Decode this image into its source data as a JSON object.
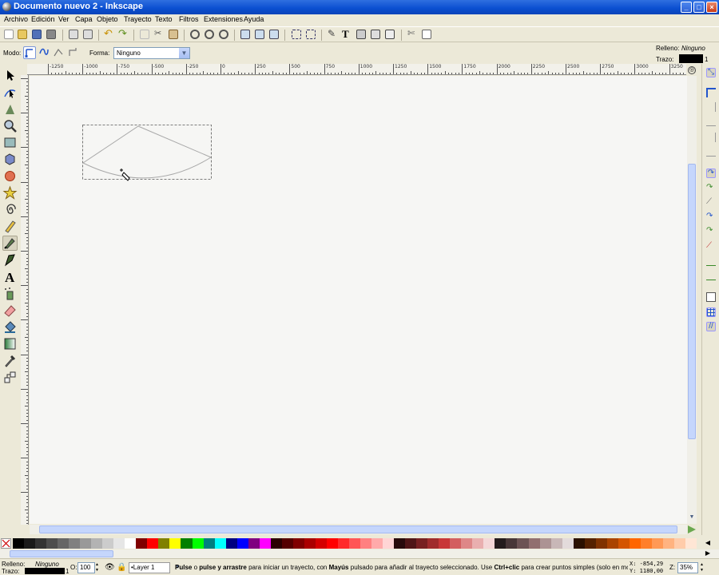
{
  "window": {
    "title": "Documento nuevo 2 - Inkscape",
    "min": "_",
    "max": "□",
    "close": "×"
  },
  "menu": [
    "Archivo",
    "Edición",
    "Ver",
    "Capa",
    "Objeto",
    "Trayecto",
    "Texto",
    "Filtros",
    "Extensiones",
    "Ayuda"
  ],
  "toolcontrols": {
    "mode_label": "Modo:",
    "shape_label": "Forma:",
    "shape_value": "Ninguno",
    "fill_label": "Relleno:",
    "fill_value": "Ninguno",
    "stroke_label": "Trazo:",
    "stroke_width": "1"
  },
  "ruler": {
    "labels": [
      "-1250",
      "-1000",
      "-750",
      "-500",
      "-250",
      "0",
      "250",
      "500",
      "750",
      "1000",
      "1250",
      "1500",
      "1750",
      "2000",
      "2250",
      "2500",
      "2750",
      "3000",
      "3250",
      "3500"
    ]
  },
  "palette": [
    "#000000",
    "#1a1a1a",
    "#333333",
    "#4d4d4d",
    "#666666",
    "#808080",
    "#999999",
    "#b3b3b3",
    "#cccccc",
    "#e6e6e6",
    "#ffffff",
    "#800000",
    "#ff0000",
    "#808000",
    "#ffff00",
    "#008000",
    "#00ff00",
    "#008080",
    "#00ffff",
    "#000080",
    "#0000ff",
    "#800080",
    "#ff00ff",
    "#2b0000",
    "#550000",
    "#800000",
    "#aa0000",
    "#d40000",
    "#ff0000",
    "#ff2a2a",
    "#ff5555",
    "#ff8080",
    "#ffaaaa",
    "#ffd5d5",
    "#280b0b",
    "#501616",
    "#782121",
    "#a02c2c",
    "#c83737",
    "#d35f5f",
    "#de8787",
    "#e9afaf",
    "#f4d7d7",
    "#241c1c",
    "#483737",
    "#6c5353",
    "#916f6f",
    "#ac9393",
    "#c8b7b7",
    "#e3dbdb",
    "#2b1100",
    "#552200",
    "#803300",
    "#aa4400",
    "#d45500",
    "#ff6600",
    "#ff7f2a",
    "#ff9955",
    "#ffb380",
    "#ffccaa",
    "#ffe6d5"
  ],
  "status": {
    "fill_label": "Relleno:",
    "fill_value": "Ninguno",
    "stroke_label": "Trazo:",
    "opacity_label": "O:",
    "opacity_value": "100",
    "layer": "•Layer 1",
    "msg_pre": "Pulse",
    "msg_b1": "o",
    "msg_b2": "pulse y arrastre",
    "msg_mid": "para iniciar un trayecto, con",
    "msg_b3": "Mayús",
    "msg_mid2": "pulsado para añadir al trayecto seleccionado. Use",
    "msg_b4": "Ctrl+clic",
    "msg_end": "para crear puntos simples (solo en modo d",
    "x_coord": "X: -854,29",
    "y_coord": "Y: 1180,00",
    "zoom_label": "Z:",
    "zoom_value": "35%"
  },
  "colors": {
    "accent": "#0a4ed0",
    "chrome": "#ece9d8",
    "canvas": "#f6f6f4"
  }
}
